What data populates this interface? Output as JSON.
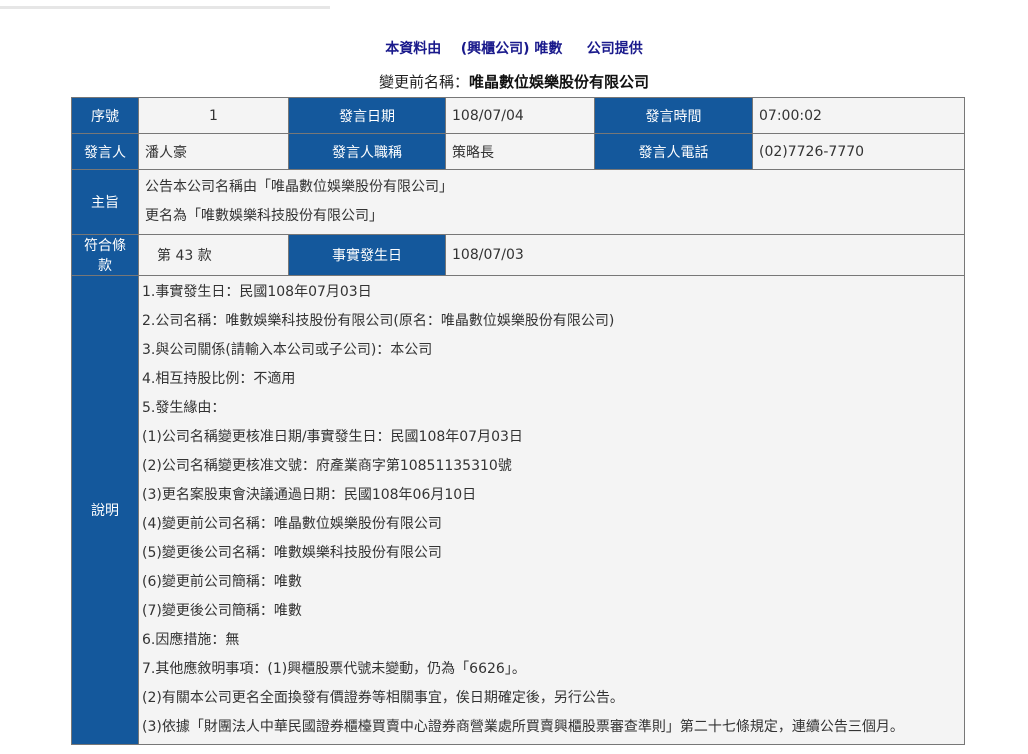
{
  "header": {
    "line1_a": "本資料由",
    "line1_b": "(興櫃公司) 唯數",
    "line1_c": "公司提供",
    "line2_label": "變更前名稱：",
    "line2_value": "唯晶數位娛樂股份有限公司"
  },
  "row1": {
    "seq_label": "序號",
    "seq_value": "1",
    "date_label": "發言日期",
    "date_value": "108/07/04",
    "time_label": "發言時間",
    "time_value": "07:00:02"
  },
  "row2": {
    "speaker_label": "發言人",
    "speaker_value": "潘人豪",
    "title_label": "發言人職稱",
    "title_value": "策略長",
    "phone_label": "發言人電話",
    "phone_value": "(02)7726-7770"
  },
  "subject": {
    "label": "主旨",
    "lines": [
      "公告本公司名稱由「唯晶數位娛樂股份有限公司」",
      "更名為「唯數娛樂科技股份有限公司」"
    ]
  },
  "row4": {
    "clause_label": "符合條款",
    "clause_value": "第 43 款",
    "event_label": "事實發生日",
    "event_value": "108/07/03"
  },
  "description": {
    "label": "說明",
    "lines": [
      "1.事實發生日：民國108年07月03日",
      "2.公司名稱：唯數娛樂科技股份有限公司(原名：唯晶數位娛樂股份有限公司)",
      "3.與公司關係(請輸入本公司或子公司)：本公司",
      "4.相互持股比例：不適用",
      "5.發生緣由：",
      "(1)公司名稱變更核准日期/事實發生日：民國108年07月03日",
      "(2)公司名稱變更核准文號：府產業商字第10851135310號",
      "(3)更名案股東會決議通過日期：民國108年06月10日",
      "(4)變更前公司名稱：唯晶數位娛樂股份有限公司",
      "(5)變更後公司名稱：唯數娛樂科技股份有限公司",
      "(6)變更前公司簡稱：唯數",
      "(7)變更後公司簡稱：唯數",
      "6.因應措施：無",
      "7.其他應敘明事項：(1)興櫃股票代號未變動，仍為「6626」。",
      "(2)有關本公司更名全面換發有價證券等相關事宜，俟日期確定後，另行公告。",
      "(3)依據「財團法人中華民國證券櫃檯買賣中心證券商營業處所買賣興櫃股票審查準則」第二十七條規定，連續公告三個月。"
    ]
  }
}
